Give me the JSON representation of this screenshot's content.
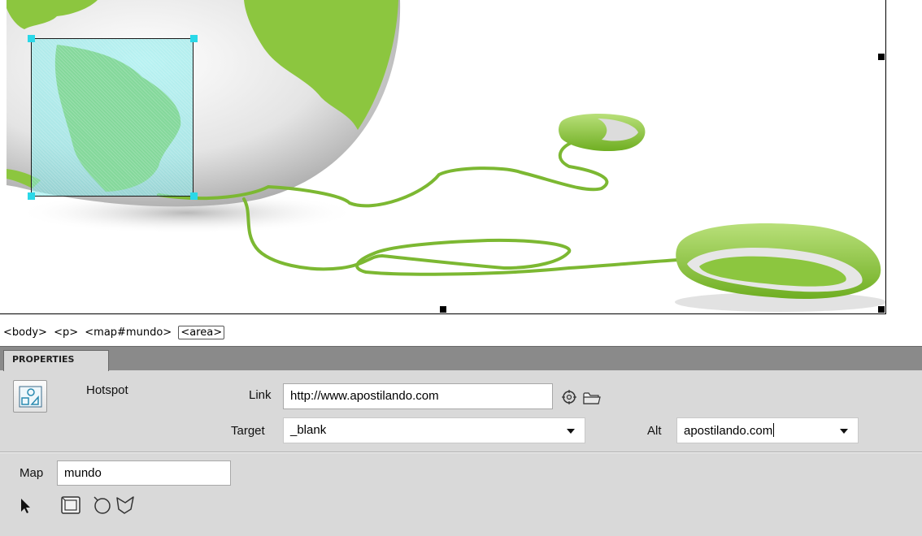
{
  "tag_selector": {
    "tags": [
      "<body>",
      "<p>",
      "<map#mundo>"
    ],
    "active_tag": "<area>"
  },
  "properties_panel": {
    "tab_label": "PROPERTIES",
    "element_type": "Hotspot",
    "link": {
      "label": "Link",
      "value": "http://www.apostilando.com"
    },
    "target": {
      "label": "Target",
      "value": "_blank"
    },
    "alt": {
      "label": "Alt",
      "value": "apostilando.com"
    },
    "map": {
      "label": "Map",
      "value": "mundo"
    },
    "tools": [
      "pointer-hotspot-tool",
      "rectangle-hotspot-tool",
      "circle-hotspot-tool",
      "polygon-hotspot-tool"
    ]
  },
  "colors": {
    "panel_bg": "#d9d9d9",
    "tab_bar_bg": "#8a8a8a",
    "hotspot_fill": "#7de8e8",
    "hotspot_handle": "#2ad8e8",
    "accent_green": "#8cc63f"
  }
}
